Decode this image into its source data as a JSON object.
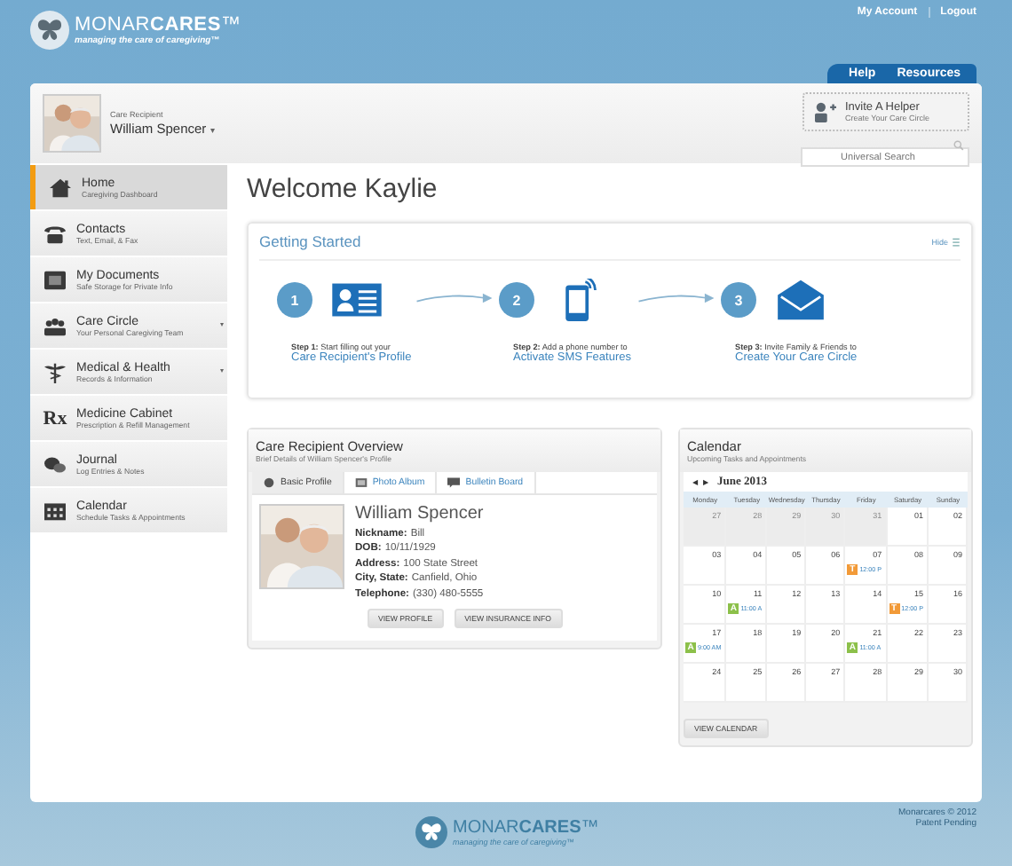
{
  "logo": {
    "name": "MONAR**CARES**™",
    "tagline": "managing the care of caregiving™"
  },
  "top_links": [
    "My Account",
    "Logout"
  ],
  "nav_tabs": [
    "Help",
    "Resources"
  ],
  "recipient": {
    "label": "Care Recipient",
    "name": "William Spencer",
    "caret": "▾"
  },
  "invite": {
    "title": "Invite A Helper",
    "subtitle": "Create Your Care Circle"
  },
  "search": {
    "placeholder": "Universal Search"
  },
  "sidebar": {
    "items": [
      {
        "title": "Home",
        "subtitle": "Caregiving Dashboard",
        "selected": true,
        "expandable": false
      },
      {
        "title": "Contacts",
        "subtitle": "Text, Email, & Fax",
        "selected": false,
        "expandable": false
      },
      {
        "title": "My Documents",
        "subtitle": "Safe Storage for Private Info",
        "selected": false,
        "expandable": false
      },
      {
        "title": "Care Circle",
        "subtitle": "Your Personal Caregiving Team",
        "selected": false,
        "expandable": true
      },
      {
        "title": "Medical & Health",
        "subtitle": "Records & Information",
        "selected": false,
        "expandable": true
      },
      {
        "glyph": "Rx",
        "title": "Medicine Cabinet",
        "subtitle": "Prescription & Refill Management",
        "selected": false,
        "expandable": false
      },
      {
        "title": "Journal",
        "subtitle": "Log Entries & Notes",
        "selected": false,
        "expandable": false
      },
      {
        "title": "Calendar",
        "subtitle": "Schedule Tasks & Appointments",
        "selected": false,
        "expandable": false
      }
    ]
  },
  "welcome": "Welcome Kaylie",
  "getting_started": {
    "title": "Getting Started",
    "hide": "Hide",
    "steps": [
      {
        "number": "1",
        "text": "**Step 1:** Start filling out your",
        "link": "Care Recipient's Profile"
      },
      {
        "number": "2",
        "text": "**Step 2:** Add a phone number to",
        "link": "Activate SMS Features"
      },
      {
        "number": "3",
        "text": "**Step 3:** Invite Family & Friends to",
        "link": "Create Your Care Circle"
      }
    ]
  },
  "overview": {
    "title": "Care Recipient Overview",
    "subtitle": "Brief Details of William Spencer's Profile",
    "tabs": [
      {
        "label": "Basic Profile",
        "selected": true
      },
      {
        "label": "Photo Album",
        "selected": false
      },
      {
        "label": "Bulletin Board",
        "selected": false
      }
    ],
    "name": "William Spencer",
    "fields": [
      {
        "label": "Nickname:",
        "value": "Bill"
      },
      {
        "label": "DOB:",
        "value": "10/11/1929"
      },
      {
        "label": "Address:",
        "value": "100 State Street"
      },
      {
        "label": "City, State:",
        "value": "Canfield, Ohio"
      },
      {
        "label": "Telephone:",
        "value": "(330) 480-5555"
      }
    ],
    "buttons": [
      "VIEW PROFILE",
      "VIEW INSURANCE INFO"
    ]
  },
  "calendar": {
    "title": "Calendar",
    "subtitle": "Upcoming Tasks and Appointments",
    "prev": "◀",
    "next": "▶",
    "month": "June 2013",
    "weekdays": [
      "Monday",
      "Tuesday",
      "Wednesday",
      "Thursday",
      "Friday",
      "Saturday",
      "Sunday"
    ],
    "weeks": [
      [
        {
          "day": "27",
          "muted": true
        },
        {
          "day": "28",
          "muted": true
        },
        {
          "day": "29",
          "muted": true
        },
        {
          "day": "30",
          "muted": true
        },
        {
          "day": "31",
          "muted": true
        },
        {
          "day": "01",
          "muted": false
        },
        {
          "day": "02",
          "muted": false
        }
      ],
      [
        {
          "day": "03",
          "muted": false
        },
        {
          "day": "04",
          "muted": false
        },
        {
          "day": "05",
          "muted": false
        },
        {
          "day": "06",
          "muted": false
        },
        {
          "day": "07",
          "muted": false,
          "event": {
            "letter": "T",
            "color": "#f29a38",
            "time": "12:00 P"
          }
        },
        {
          "day": "08",
          "muted": false
        },
        {
          "day": "09",
          "muted": false
        }
      ],
      [
        {
          "day": "10",
          "muted": false
        },
        {
          "day": "11",
          "muted": false,
          "event": {
            "letter": "A",
            "color": "#8cc04a",
            "time": "11:00 A"
          }
        },
        {
          "day": "12",
          "muted": false
        },
        {
          "day": "13",
          "muted": false
        },
        {
          "day": "14",
          "muted": false
        },
        {
          "day": "15",
          "muted": false,
          "event": {
            "letter": "T",
            "color": "#f29a38",
            "time": "12:00 P"
          }
        },
        {
          "day": "16",
          "muted": false
        }
      ],
      [
        {
          "day": "17",
          "muted": false,
          "event": {
            "letter": "A",
            "color": "#8cc04a",
            "time": "9:00 AM"
          }
        },
        {
          "day": "18",
          "muted": false
        },
        {
          "day": "19",
          "muted": false
        },
        {
          "day": "20",
          "muted": false
        },
        {
          "day": "21",
          "muted": false,
          "event": {
            "letter": "A",
            "color": "#8cc04a",
            "time": "11:00 A"
          }
        },
        {
          "day": "22",
          "muted": false
        },
        {
          "day": "23",
          "muted": false
        }
      ],
      [
        {
          "day": "24",
          "muted": false
        },
        {
          "day": "25",
          "muted": false
        },
        {
          "day": "26",
          "muted": false
        },
        {
          "day": "27",
          "muted": false
        },
        {
          "day": "28",
          "muted": false
        },
        {
          "day": "29",
          "muted": false
        },
        {
          "day": "30",
          "muted": false
        }
      ]
    ],
    "button": "VIEW CALENDAR"
  },
  "footer": {
    "logo": "MONAR**CARES**™",
    "tagline": "managing the care of caregiving™",
    "copyright": "Monarcares © 2012",
    "patent": "Patent Pending"
  }
}
